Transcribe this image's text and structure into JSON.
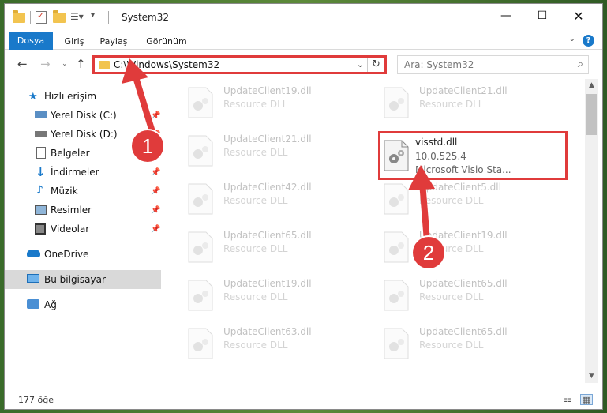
{
  "window": {
    "title": "System32"
  },
  "ribbon": {
    "tabs": [
      "Dosya",
      "Giriş",
      "Paylaş",
      "Görünüm"
    ],
    "help": "?"
  },
  "address": {
    "path": "C:\\Windows\\System32",
    "search_placeholder": "Ara: System32"
  },
  "nav": {
    "quick_access": "Hızlı erişim",
    "items": [
      {
        "label": "Yerel Disk (C:)",
        "icon": "drive-icon",
        "pinned": true
      },
      {
        "label": "Yerel Disk (D:)",
        "icon": "drive-icon",
        "pinned": true
      },
      {
        "label": "Belgeler",
        "icon": "documents-icon",
        "pinned": true
      },
      {
        "label": "İndirmeler",
        "icon": "downloads-icon",
        "pinned": true
      },
      {
        "label": "Müzik",
        "icon": "music-icon",
        "pinned": true
      },
      {
        "label": "Resimler",
        "icon": "pictures-icon",
        "pinned": true
      },
      {
        "label": "Videolar",
        "icon": "videos-icon",
        "pinned": true
      }
    ],
    "onedrive": "OneDrive",
    "this_pc": "Bu bilgisayar",
    "network": "Ağ"
  },
  "files": {
    "left": [
      {
        "name": "UpdateClient19.dll",
        "sub": "Resource DLL"
      },
      {
        "name": "UpdateClient21.dll",
        "sub": "Resource DLL"
      },
      {
        "name": "UpdateClient42.dll",
        "sub": "Resource DLL"
      },
      {
        "name": "UpdateClient65.dll",
        "sub": "Resource DLL"
      },
      {
        "name": "UpdateClient19.dll",
        "sub": "Resource DLL"
      },
      {
        "name": "UpdateClient63.dll",
        "sub": "Resource DLL"
      }
    ],
    "right": [
      {
        "name": "UpdateClient21.dll",
        "sub": "Resource DLL"
      },
      {
        "name": "UpdateClient5.dll",
        "sub": "Resource DLL"
      },
      {
        "name": "UpdateClient19.dll",
        "sub": "Resource DLL"
      },
      {
        "name": "UpdateClient65.dll",
        "sub": "Resource DLL"
      },
      {
        "name": "UpdateClient65.dll",
        "sub": "Resource DLL"
      }
    ],
    "highlighted": {
      "name": "visstd.dll",
      "version": "10.0.525.4",
      "description": "Microsoft Visio Sta..."
    }
  },
  "status": {
    "count": "177 öğe"
  },
  "annotations": {
    "badge1": "1",
    "badge2": "2",
    "color": "#e03b3b"
  }
}
